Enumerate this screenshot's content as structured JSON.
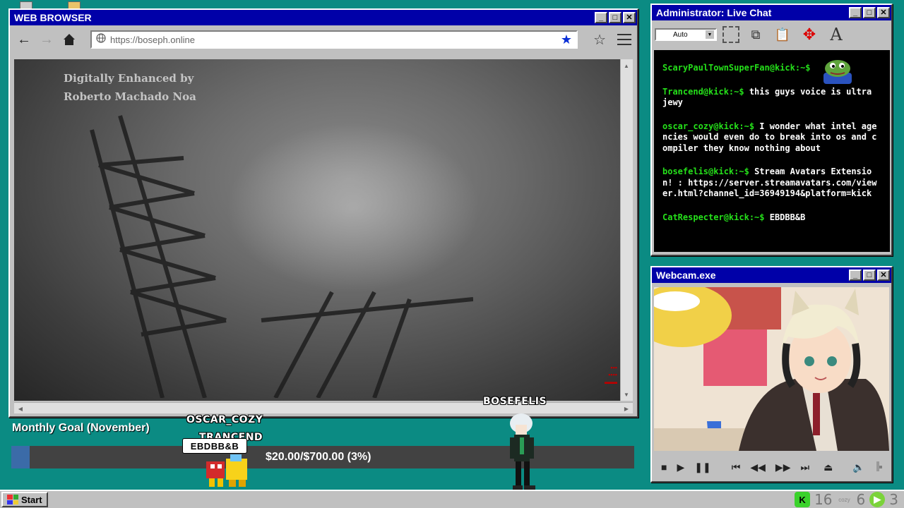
{
  "browser": {
    "title": "WEB BROWSER",
    "url": "https://boseph.online",
    "video": {
      "credit_line1": "Digitally Enhanced by",
      "credit_line2": "Roberto Machado Noa"
    }
  },
  "chat": {
    "title": "Administrator: Live Chat",
    "font_select": "Auto",
    "messages": [
      {
        "user": "ScaryPaulTownSuperFan@kick:~$",
        "text": ""
      },
      {
        "user": "Trancend@kick:~$",
        "text": "this guys voice is ultra jewy"
      },
      {
        "user": "oscar_cozy@kick:~$",
        "text": "I wonder what intel agencies would even do to break into os and compiler they know nothing about"
      },
      {
        "user": "bosefelis@kick:~$",
        "text": "Stream Avatars Extension! : https://server.streamavatars.com/viewer.html?channel_id=36949194&platform=kick"
      },
      {
        "user": "CatRespecter@kick:~$",
        "text": "EBDBB&B"
      }
    ],
    "colors": {
      "username": "#25e01a",
      "background": "#000000"
    }
  },
  "webcam": {
    "title": "Webcam.exe"
  },
  "goal": {
    "title": "Monthly Goal (November)",
    "amount_text": "$20.00/$700.00 (3%)",
    "progress": 0.03,
    "colors": {
      "fill": "#3b6ba8",
      "track": "#424242"
    }
  },
  "avatars": {
    "oscar": "OSCAR_COZY",
    "trancend": "TRANCEND",
    "bubble": "EBDBB&B",
    "bosefelis": "BOSEFELIS"
  },
  "taskbar": {
    "start_label": "Start",
    "tray_count_kick": "16",
    "tray_small_label": "cozy",
    "tray_count_6": "6",
    "tray_count_3": "3"
  },
  "icons": {
    "back": "arrow-left-icon",
    "forward": "arrow-right-icon",
    "home": "home-icon",
    "globe": "globe-icon",
    "bookmark_filled": "star-filled-icon",
    "bookmark_outline": "star-outline-icon",
    "menu": "hamburger-menu-icon"
  }
}
